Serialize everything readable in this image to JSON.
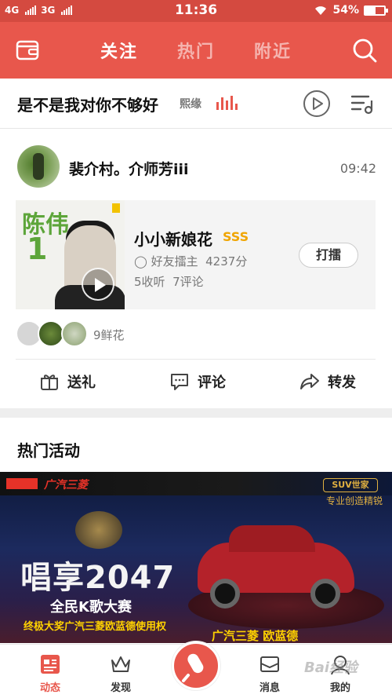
{
  "status": {
    "carrier1": "4G",
    "carrier2": "3G",
    "time": "11:36",
    "battery": "54%",
    "battery_level": 0.54
  },
  "header": {
    "tabs": [
      {
        "label": "关注",
        "active": true
      },
      {
        "label": "热门",
        "active": false
      },
      {
        "label": "附近",
        "active": false
      }
    ],
    "icons": [
      "wallet-icon",
      "search-icon"
    ]
  },
  "now_playing": {
    "song": "是不是我对你不够好",
    "singer": "熙缘",
    "icons": [
      "equalizer-icon",
      "play-icon",
      "playlist-icon"
    ]
  },
  "post": {
    "username": "裴介村。介师芳iii",
    "time": "09:42",
    "song_title": "小小新娘花",
    "rank_badge": "SSS",
    "host_label": "好友擂主",
    "score": "4237分",
    "listens": "5收听",
    "comments": "7评论",
    "challenge_button": "打擂",
    "cover_text": "陈伟",
    "cover_number": "1",
    "flowers": "9鲜花",
    "actions": [
      {
        "label": "送礼",
        "icon": "gift-icon"
      },
      {
        "label": "评论",
        "icon": "comment-icon"
      },
      {
        "label": "转发",
        "icon": "share-icon"
      }
    ]
  },
  "hot": {
    "title": "热门活动",
    "banner": {
      "brand": "广汽三菱",
      "badge": "SUV世家",
      "tagline_top": "专业创造精锐",
      "headline": "唱享2047",
      "subline": "全民K歌大赛",
      "prize": "终极大奖广汽三菱欧蓝德使用权",
      "footer": "广汽三菱 欧蓝德"
    }
  },
  "bottom_nav": [
    {
      "label": "动态",
      "active": true,
      "icon": "feed-icon"
    },
    {
      "label": "发现",
      "active": false,
      "icon": "crown-icon"
    },
    {
      "label": "",
      "active": false,
      "icon": "microphone-icon"
    },
    {
      "label": "消息",
      "active": false,
      "icon": "message-icon"
    },
    {
      "label": "我的",
      "active": false,
      "icon": "profile-icon"
    }
  ],
  "watermark": "Bai经验"
}
